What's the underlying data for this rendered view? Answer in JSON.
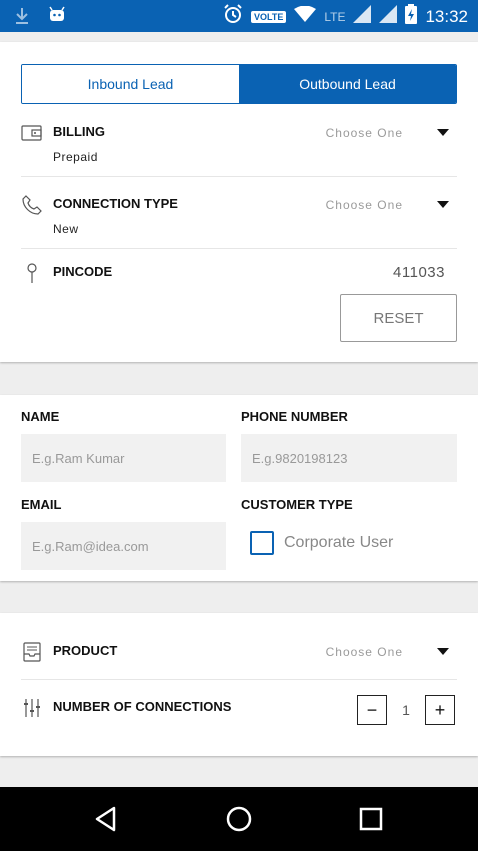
{
  "status_bar": {
    "volte": "VOLTE",
    "network": "LTE",
    "time": "13:32"
  },
  "lead_toggle": {
    "inbound": "Inbound Lead",
    "outbound": "Outbound Lead",
    "selected": "Outbound Lead"
  },
  "billing": {
    "label": "BILLING",
    "value": "Prepaid",
    "placeholder": "Choose One"
  },
  "connection_type": {
    "label": "CONNECTION TYPE",
    "value": "New",
    "placeholder": "Choose One"
  },
  "pincode": {
    "label": "PINCODE",
    "value": "411033"
  },
  "reset_label": "RESET",
  "customer": {
    "name_label": "NAME",
    "name_placeholder": "E.g.Ram Kumar",
    "phone_label": "PHONE NUMBER",
    "phone_placeholder": "E.g.9820198123",
    "email_label": "EMAIL",
    "email_placeholder": "E.g.Ram@idea.com",
    "type_label": "CUSTOMER TYPE",
    "type_option": "Corporate User"
  },
  "product": {
    "label": "PRODUCT",
    "placeholder": "Choose One"
  },
  "connections": {
    "label": "NUMBER OF CONNECTIONS",
    "count": "1",
    "minus": "−",
    "plus": "+"
  },
  "colors": {
    "primary": "#0a62b3",
    "background": "#eeeeee"
  }
}
